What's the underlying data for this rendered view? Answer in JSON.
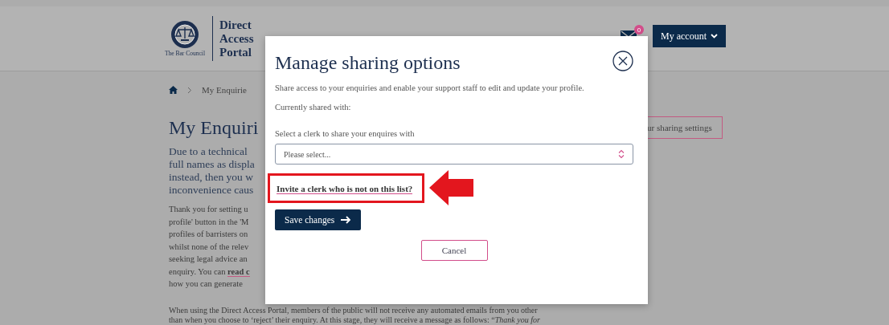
{
  "header": {
    "logo": {
      "caption": "The Bar Council",
      "title_lines": [
        "Direct",
        "Access",
        "Portal"
      ]
    },
    "messages_badge": "0",
    "account_button": "My account"
  },
  "page": {
    "breadcrumb": "My Enquirie",
    "heading": "My Enquiri",
    "sharing_button": "ur sharing settings",
    "lead_lines": [
      "Due to a technical",
      "full names as displa",
      "instead, then you w",
      "inconvenience caus"
    ],
    "body_lines": [
      {
        "text": "Thank you for setting u"
      },
      {
        "text": "profile' button in the 'M"
      },
      {
        "text": "profiles of barristers on"
      },
      {
        "text": "whilst none of the relev"
      },
      {
        "text": "seeking legal advice an"
      },
      {
        "text": "enquiry. You can ",
        "link": "read c"
      },
      {
        "text": "how you can generate"
      }
    ],
    "footer_lines": [
      "When using the Direct Access Portal, members of the public will not receive any automated emails from you other",
      "than when you choose to ‘reject’ their enquiry. At this stage, they will receive a message as follows: “*Thank you for*"
    ]
  },
  "modal": {
    "title": "Manage sharing options",
    "description": "Share access to your enquiries and enable your support staff to edit and update your profile.",
    "shared_label": "Currently shared with:",
    "select_label": "Select a clerk to share your enquires with",
    "select": {
      "placeholder": "Please select..."
    },
    "invite_link": "Invite a clerk who is not on this list?",
    "save_button": "Save changes",
    "cancel_button": "Cancel"
  }
}
